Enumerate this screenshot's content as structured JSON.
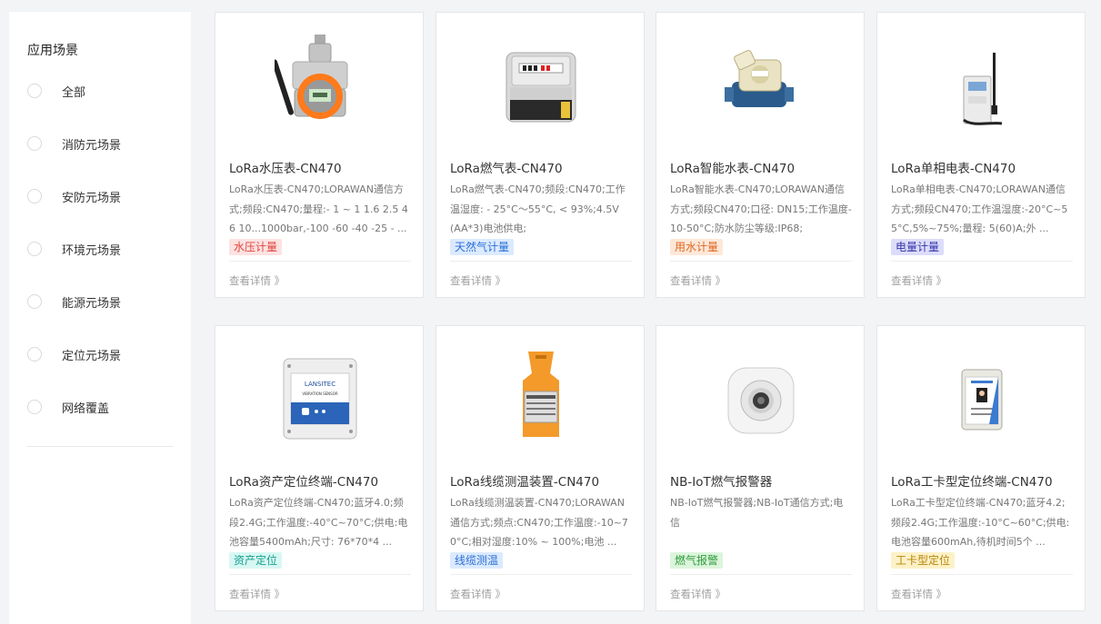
{
  "sidebar": {
    "title": "应用场景",
    "items": [
      {
        "label": "全部"
      },
      {
        "label": "消防元场景"
      },
      {
        "label": "安防元场景"
      },
      {
        "label": "环境元场景"
      },
      {
        "label": "能源元场景"
      },
      {
        "label": "定位元场景"
      },
      {
        "label": "网络覆盖"
      }
    ]
  },
  "products": [
    {
      "title": "LoRa水压表-CN470",
      "desc": "LoRa水压表-CN470;LORAWAN通信方式;频段:CN470;量程:- 1 ~ 1 1.6 2.5 4 6 10...1000bar,-100 -60 -40 -25 - ...",
      "tag": "水压计量",
      "tag_bg": "#fde2e2",
      "tag_color": "#e0443a",
      "more": "查看详情 》"
    },
    {
      "title": "LoRa燃气表-CN470",
      "desc": "LoRa燃气表-CN470;频段:CN470;工作温湿度: - 25°C～55°C, < 93%;4.5V (AA*3)电池供电;",
      "tag": "天然气计量",
      "tag_bg": "#dbeafe",
      "tag_color": "#2b6fd6",
      "more": "查看详情 》"
    },
    {
      "title": "LoRa智能水表-CN470",
      "desc": "LoRa智能水表-CN470;LORAWAN通信方式;频段CN470;口径: DN15;工作温度-10-50°C;防水防尘等级:IP68;",
      "tag": "用水计量",
      "tag_bg": "#fde8d8",
      "tag_color": "#e0651f",
      "more": "查看详情 》"
    },
    {
      "title": "LoRa单相电表-CN470",
      "desc": "LoRa单相电表-CN470;LORAWAN通信方式;频段CN470;工作温湿度:-20°C~55°C,5%~75%;量程: 5(60)A;外 ...",
      "tag": "电量计量",
      "tag_bg": "#dcdcfb",
      "tag_color": "#3535a8",
      "more": "查看详情 》"
    },
    {
      "title": "LoRa资产定位终端-CN470",
      "desc": "LoRa资产定位终端-CN470;蓝牙4.0;频段2.4G;工作温度:-40°C~70°C;供电:电池容量5400mAh;尺寸: 76*70*4 ...",
      "tag": "资产定位",
      "tag_bg": "#d8f7f3",
      "tag_color": "#14a08f",
      "more": "查看详情 》"
    },
    {
      "title": "LoRa线缆测温装置-CN470",
      "desc": "LoRa线缆测温装置-CN470;LORAWAN通信方式;频点:CN470;工作温度:-10~70°C;相对湿度:10% ~ 100%;电池 ...",
      "tag": "线缆测温",
      "tag_bg": "#dbeafe",
      "tag_color": "#2b6fd6",
      "more": "查看详情 》"
    },
    {
      "title": "NB-IoT燃气报警器",
      "desc": "NB-IoT燃气报警器;NB-IoT通信方式;电信",
      "tag": "燃气报警",
      "tag_bg": "#dcf5dc",
      "tag_color": "#2e9a3a",
      "more": "查看详情 》"
    },
    {
      "title": "LoRa工卡型定位终端-CN470",
      "desc": "LoRa工卡型定位终端-CN470;蓝牙4.2;频段2.4G;工作温度:-10°C~60°C;供电:电池容量600mAh,待机时间5个 ...",
      "tag": "工卡型定位",
      "tag_bg": "#fdf1c7",
      "tag_color": "#b8860b",
      "more": "查看详情 》"
    }
  ],
  "images": {
    "vibration_sensor_brand": "LANSITEC",
    "vibration_sensor_label": "VIBRATION SENSOR"
  }
}
